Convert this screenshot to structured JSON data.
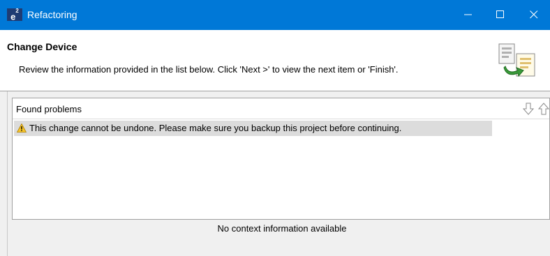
{
  "window": {
    "app_icon_text": "e",
    "app_icon_sup": "2",
    "title": "Refactoring",
    "accent_color": "#0078d7"
  },
  "header": {
    "title": "Change Device",
    "description": "Review the information provided in the list below. Click 'Next >' to view the next item or 'Finish'.",
    "icon": "refactor-wizard-icon"
  },
  "problems": {
    "title": "Found problems",
    "nav_icons": [
      "arrow-down-icon",
      "arrow-up-icon"
    ],
    "items": [
      {
        "severity_icon": "warning-icon",
        "text": "This change cannot be undone. Please make sure you backup this project before continuing."
      }
    ]
  },
  "context": {
    "text": "No context information available"
  }
}
